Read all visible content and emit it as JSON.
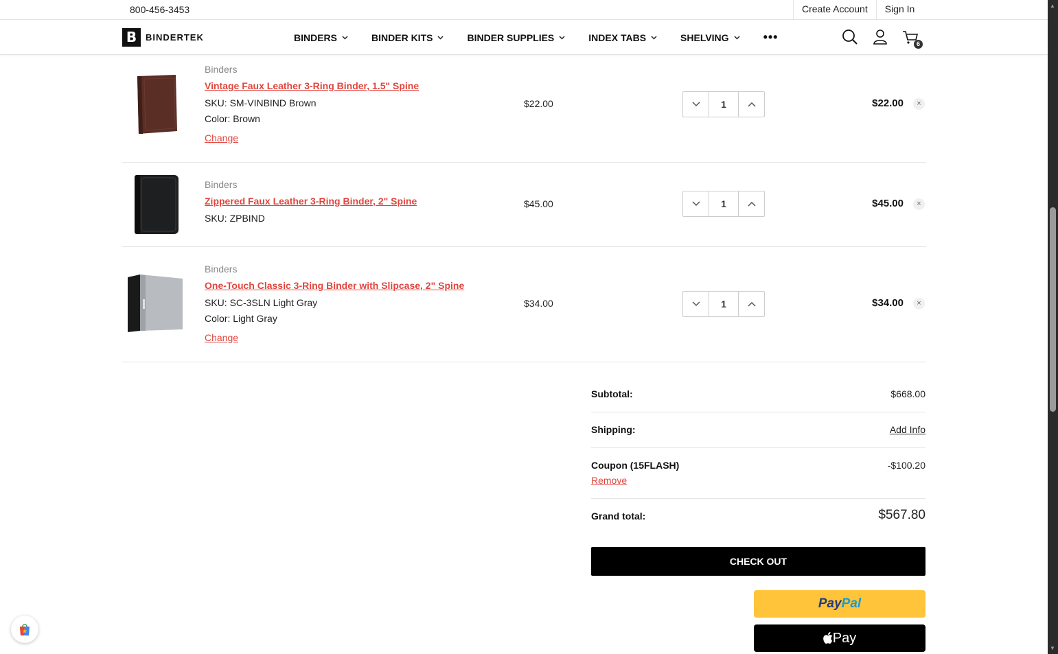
{
  "utility": {
    "phone": "800-456-3453",
    "create_account": "Create Account",
    "sign_in": "Sign In"
  },
  "brand": {
    "logo_letter": "B",
    "name": "BINDERTEK"
  },
  "nav": {
    "items": [
      {
        "label": "BINDERS"
      },
      {
        "label": "BINDER KITS"
      },
      {
        "label": "BINDER SUPPLIES"
      },
      {
        "label": "INDEX TABS"
      },
      {
        "label": "SHELVING"
      }
    ],
    "more": "•••",
    "icons": [
      "search-icon",
      "account-icon",
      "cart-icon"
    ],
    "cart_count": "6"
  },
  "cart": {
    "items": [
      {
        "category": "Binders",
        "name": "Vintage Faux Leather 3-Ring Binder, 1.5\" Spine",
        "sku": "SKU:  SM-VINBIND Brown",
        "color": "Color:  Brown",
        "change": "Change",
        "price": "$22.00",
        "qty": "1",
        "total": "$22.00",
        "remove": "×",
        "image_color": "#5a2e25"
      },
      {
        "category": "Binders",
        "name": "Zippered Faux Leather 3-Ring Binder, 2\" Spine",
        "sku": "SKU:  ZPBIND",
        "price": "$45.00",
        "qty": "1",
        "total": "$45.00",
        "remove": "×",
        "image_color": "#1e1f21"
      },
      {
        "category": "Binders",
        "name": "One-Touch Classic 3-Ring Binder with Slipcase, 2\" Spine",
        "sku": "SKU:  SC-3SLN Light Gray",
        "color": "Color:  Light Gray",
        "change": "Change",
        "price": "$34.00",
        "qty": "1",
        "total": "$34.00",
        "remove": "×",
        "image_color": "#b8bcc0"
      }
    ]
  },
  "totals": {
    "subtotal_label": "Subtotal:",
    "subtotal_value": "$668.00",
    "shipping_label": "Shipping:",
    "shipping_value": "Add Info",
    "coupon_label": "Coupon (15FLASH)",
    "coupon_value": "-$100.20",
    "coupon_remove": "Remove",
    "grand_label": "Grand total:",
    "grand_value": "$567.80"
  },
  "actions": {
    "checkout": "CHECK OUT",
    "paypal_a": "Pay",
    "paypal_b": "Pal",
    "applepay": "Pay"
  },
  "colors": {
    "accent_link": "#e0463e",
    "paypal_yellow": "#ffc439",
    "checkout_black": "#000000"
  }
}
